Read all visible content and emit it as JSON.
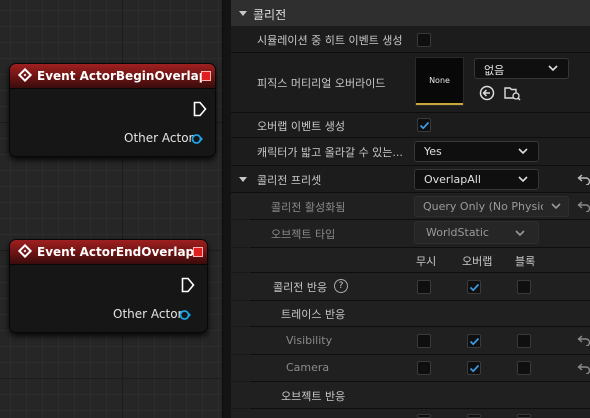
{
  "graph": {
    "nodes": [
      {
        "title": "Event ActorBeginOverlap",
        "pin_label": "Other Actor"
      },
      {
        "title": "Event ActorEndOverlap",
        "pin_label": "Other Actor"
      }
    ]
  },
  "panel": {
    "section_title": "콜리전",
    "rows": {
      "sim_hit": {
        "label": "시뮬레이션 중 히트 이벤트 생성",
        "checked": false
      },
      "phys_mat": {
        "label": "피직스 머티리얼 오버라이드",
        "thumb_text": "None",
        "combo_value": "없음"
      },
      "overlap_events": {
        "label": "오버랩 이벤트 생성",
        "checked": true
      },
      "step_up": {
        "label": "캐릭터가 밟고 올라갈 수 있는...",
        "value": "Yes"
      },
      "preset": {
        "label": "콜리전 프리셋",
        "value": "OverlapAll"
      },
      "coll_enabled": {
        "label": "콜리전 활성화됨",
        "value": "Query Only (No Physics"
      },
      "obj_type": {
        "label": "오브젝트 타입",
        "value": "WorldStatic"
      },
      "columns": {
        "ignore": "무시",
        "overlap": "오버랩",
        "block": "블록"
      },
      "responses": {
        "label": "콜리전 반응",
        "help": "?"
      },
      "trace_header": {
        "label": "트레이스 반응"
      },
      "visibility": {
        "label": "Visibility"
      },
      "camera": {
        "label": "Camera"
      },
      "object_header": {
        "label": "오브젝트 반응"
      }
    }
  }
}
